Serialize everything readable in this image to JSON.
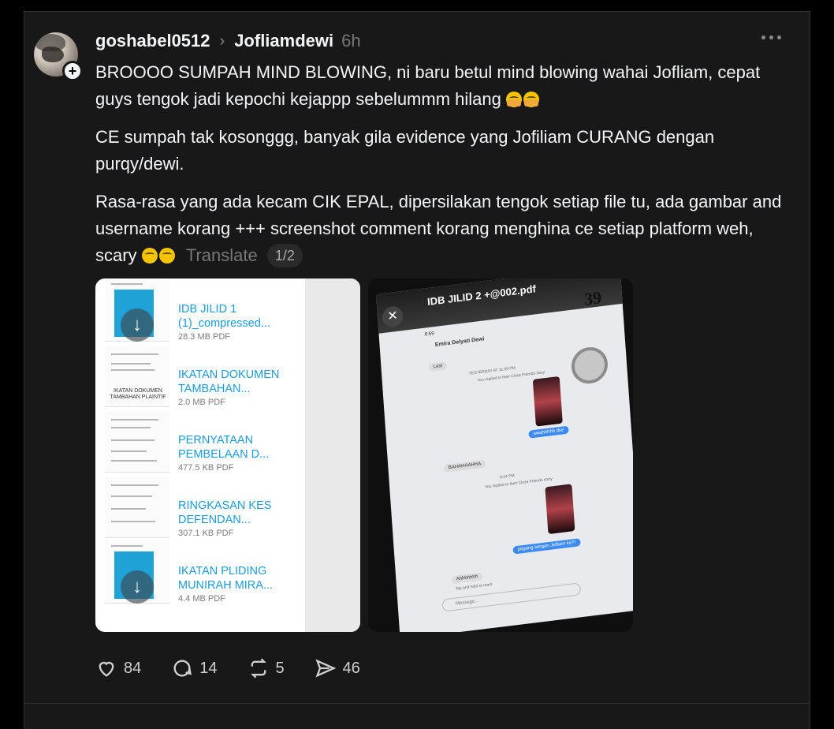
{
  "post": {
    "author": "goshabel0512",
    "reply_to": "Jofliamdewi",
    "time": "6h",
    "paragraphs": {
      "p1": "BROOOO SUMPAH MIND BLOWING, ni baru betul mind blowing wahai Jofliam, cepat guys tengok jadi kepochi kejappp sebelummm hilang",
      "p2": "CE sumpah tak kosonggg, banyak gila evidence yang Jofiliam CURANG dengan purqy/dewi.",
      "p3": "Rasa-rasa yang ada kecam CIK EPAL, dipersilakan tengok setiap file tu, ada gambar and username korang +++ screenshot comment korang menghina ce setiap platform weh, scary"
    },
    "translate_label": "Translate",
    "carousel_indicator": "1/2"
  },
  "files": [
    {
      "name": "IDB JILID 1 (1)_compressed...",
      "size": "28.3 MB PDF"
    },
    {
      "name": "IKATAN DOKUMEN TAMBAHAN...",
      "size": "2.0 MB PDF",
      "thumb_caption": "IKATAN DOKUMEN TAMBAHAN PLAINTIF"
    },
    {
      "name": "PERNYATAAN PEMBELAAN D...",
      "size": "477.5 KB PDF"
    },
    {
      "name": "RINGKASAN KES DEFENDAN...",
      "size": "307.1 KB PDF"
    },
    {
      "name": "IKATAN PLIDING MUNIRAH MIRA...",
      "size": "4.4 MB PDF"
    }
  ],
  "photo": {
    "pdf_title": "IDB JILID 2 +@002.pdf",
    "page_number": "39",
    "status_time": "8:59",
    "chat_name": "Emira Delyati Dewi",
    "messages": {
      "m1": "Last",
      "sys1": "YESTERDAY AT 11:59 PM",
      "sys2": "You replied to their Close Friends story",
      "m2": "awahhhhh dia!",
      "m3": "BAHAHAAHHA",
      "sys3": "8:24 PM",
      "sys4": "You replied to their Close Friends story",
      "m4": "pegang tangan Jofliam ke?!",
      "m5": "Ahhhhhhh",
      "sys5": "Tap and hold to react",
      "input": "Message..."
    }
  },
  "actions": {
    "likes": "84",
    "comments": "14",
    "reposts": "5",
    "shares": "46"
  }
}
